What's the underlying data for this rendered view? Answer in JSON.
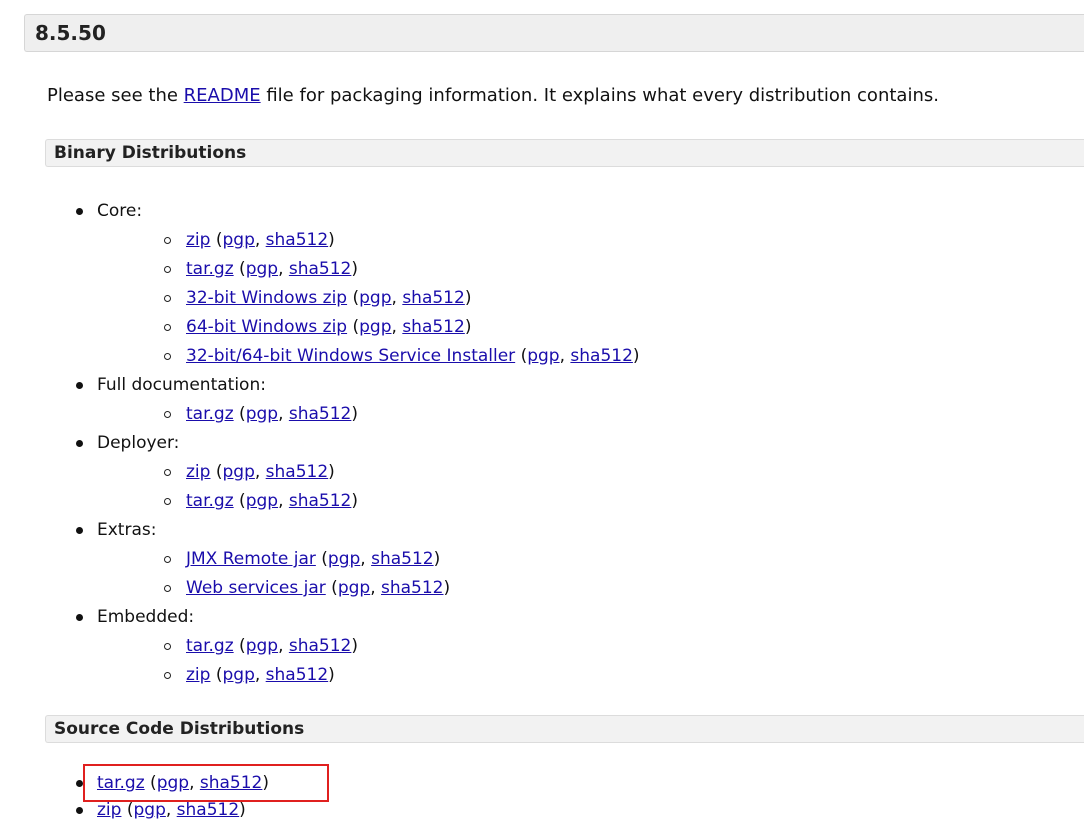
{
  "version_title": "8.5.50",
  "intro": {
    "prefix": "Please see the ",
    "readme_link": "README",
    "suffix": " file for packaging information. It explains what every distribution contains."
  },
  "binary": {
    "title": "Binary Distributions",
    "core_label": "Core:",
    "core_items": [
      {
        "file": "zip",
        "pgp": "pgp",
        "sha": "sha512"
      },
      {
        "file": "tar.gz",
        "pgp": "pgp",
        "sha": "sha512"
      },
      {
        "file": "32-bit Windows zip",
        "pgp": "pgp",
        "sha": "sha512"
      },
      {
        "file": "64-bit Windows zip",
        "pgp": "pgp",
        "sha": "sha512"
      },
      {
        "file": "32-bit/64-bit Windows Service Installer",
        "pgp": "pgp",
        "sha": "sha512"
      }
    ],
    "fulldoc_label": "Full documentation:",
    "fulldoc_items": [
      {
        "file": "tar.gz",
        "pgp": "pgp",
        "sha": "sha512"
      }
    ],
    "deployer_label": "Deployer:",
    "deployer_items": [
      {
        "file": "zip",
        "pgp": "pgp",
        "sha": "sha512"
      },
      {
        "file": "tar.gz",
        "pgp": "pgp",
        "sha": "sha512"
      }
    ],
    "extras_label": "Extras:",
    "extras_items": [
      {
        "file": "JMX Remote jar",
        "pgp": "pgp",
        "sha": "sha512"
      },
      {
        "file": "Web services jar",
        "pgp": "pgp",
        "sha": "sha512"
      }
    ],
    "embedded_label": "Embedded:",
    "embedded_items": [
      {
        "file": "tar.gz",
        "pgp": "pgp",
        "sha": "sha512"
      },
      {
        "file": "zip",
        "pgp": "pgp",
        "sha": "sha512"
      }
    ]
  },
  "source": {
    "title": "Source Code Distributions",
    "items": [
      {
        "file": "tar.gz",
        "pgp": "pgp",
        "sha": "sha512"
      },
      {
        "file": "zip",
        "pgp": "pgp",
        "sha": "sha512"
      }
    ]
  },
  "punct": {
    "open": " (",
    "comma": ", ",
    "close": ")"
  },
  "colors": {
    "link": "#1a0dab",
    "highlight": "#e0201f"
  }
}
